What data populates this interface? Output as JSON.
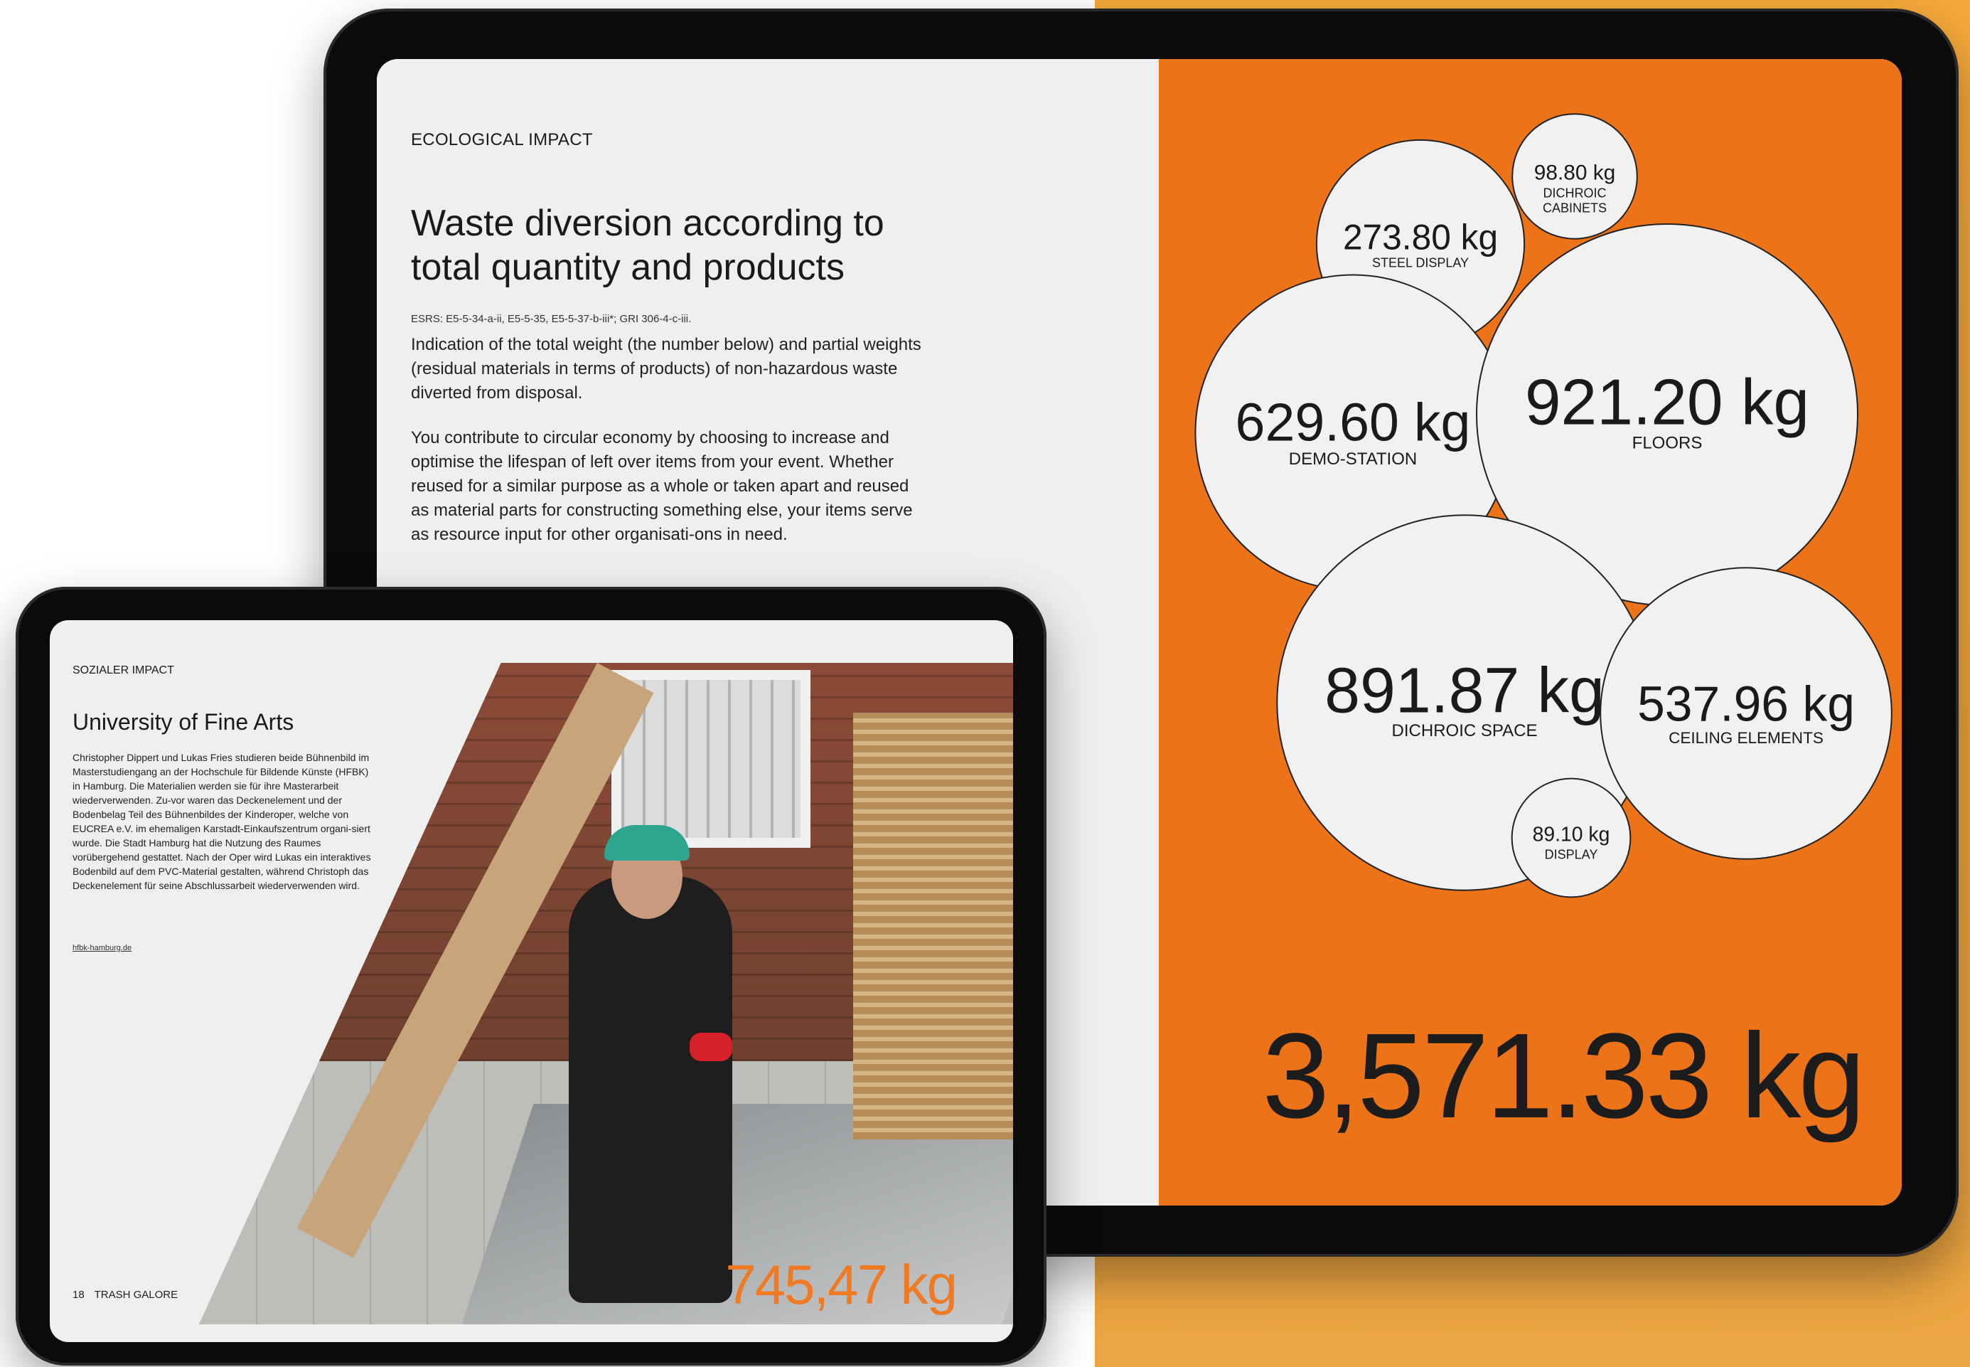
{
  "colors": {
    "accent_orange": "#ec7317",
    "background_orange": "#f0a33c",
    "device_frame": "#0b0b0b",
    "page_bg": "#efefef",
    "bubble_fill": "#f1f1f1"
  },
  "big_tablet": {
    "kicker": "ECOLOGICAL IMPACT",
    "title_line1": "Waste diversion according to",
    "title_line2": "total quantity and products",
    "references": "ESRS: E5-5-34-a-ii, E5-5-35,  E5-5-37-b-iii*; GRI 306-4-c-iii.",
    "paragraph1": "Indication of the total weight (the number below) and partial weights (residual materials in terms of products) of non-hazardous waste diverted from disposal.",
    "paragraph2": "You contribute to circular economy by choosing to increase and optimise the lifespan of left over items from your event. Whether reused for a similar purpose as a whole or taken apart and reused as material parts for constructing something else, your items serve as resource input for other organisati-ons in need.",
    "total_weight": "3,571.33 kg"
  },
  "chart_data": {
    "type": "bubble",
    "title": "Waste diversion according to total quantity and products",
    "unit": "kg",
    "items": [
      {
        "name": "DICHROIC CABINETS",
        "label": "98.80 kg",
        "value": 98.8
      },
      {
        "name": "STEEL DISPLAY",
        "label": "273.80 kg",
        "value": 273.8
      },
      {
        "name": "DEMO-STATION",
        "label": "629.60 kg",
        "value": 629.6
      },
      {
        "name": "FLOORS",
        "label": "921.20 kg",
        "value": 921.2
      },
      {
        "name": "DICHROIC SPACE",
        "label": "891.87 kg",
        "value": 891.87
      },
      {
        "name": "CEILING ELEMENTS",
        "label": "537.96 kg",
        "value": 537.96
      },
      {
        "name": "DISPLAY",
        "label": "89.10 kg",
        "value": 89.1
      }
    ],
    "total": 3571.33
  },
  "small_tablet": {
    "kicker": "SOZIALER IMPACT",
    "title": "University of Fine Arts",
    "body": "Christopher Dippert und Lukas Fries studieren beide Bühnenbild im Masterstudiengang an der Hochschule für Bildende Künste (HFBK) in Hamburg. Die Materialien werden sie für ihre Masterarbeit wiederverwenden. Zu-vor waren das Deckenelement und der Bodenbelag Teil des Bühnenbildes der Kinderoper, welche von EUCREA e.V. im ehemaligen Karstadt-Einkaufszentrum organi-siert wurde. Die Stadt Hamburg hat die Nutzung des Raumes vorübergehend gestattet. Nach der Oper wird Lukas ein interaktives Bodenbild auf dem PVC-Material gestalten, während Christoph das Deckenelement für seine Abschlussarbeit wiederverwenden wird.",
    "link": "hfbk-hamburg.de",
    "page_number": "18",
    "brand": "TRASH GALORE",
    "photo_weight": "745,47 kg"
  }
}
